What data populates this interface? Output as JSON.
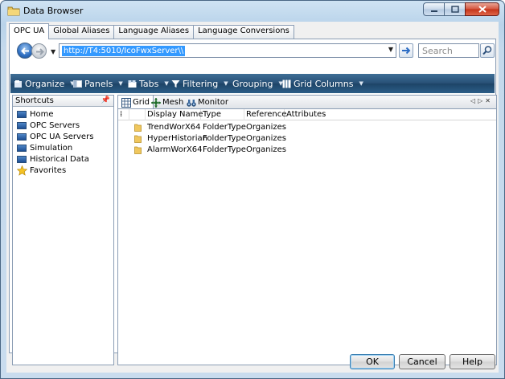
{
  "window": {
    "title": "Data Browser"
  },
  "top_tabs": [
    "OPC UA",
    "Global Aliases",
    "Language Aliases",
    "Language Conversions"
  ],
  "address": {
    "value": "http://T4:5010/IcoFwxServer\\\\",
    "search_placeholder": "Search"
  },
  "toolbar": {
    "items": [
      "Organize",
      "Panels",
      "Tabs",
      "Filtering",
      "Grouping",
      "Grid Columns"
    ]
  },
  "shortcuts": {
    "title": "Shortcuts",
    "items": [
      "Home",
      "OPC Servers",
      "OPC UA Servers",
      "Simulation",
      "Historical Data",
      "Favorites"
    ]
  },
  "inner_tabs": [
    "Grid",
    "Mesh",
    "Monitor"
  ],
  "grid": {
    "columns": [
      "Display Name",
      "Type",
      "Reference",
      "Attributes"
    ],
    "rows": [
      {
        "display_name": "TrendWorX64",
        "type": "FolderType",
        "reference": "Organizes"
      },
      {
        "display_name": "HyperHistorian",
        "type": "FolderType",
        "reference": "Organizes"
      },
      {
        "display_name": "AlarmWorX64",
        "type": "FolderType",
        "reference": "Organizes"
      }
    ]
  },
  "buttons": {
    "ok": "OK",
    "cancel": "Cancel",
    "help": "Help"
  },
  "colors": {
    "toolbar": "#274f75",
    "selection": "#3399ff",
    "close": "#c43419"
  }
}
